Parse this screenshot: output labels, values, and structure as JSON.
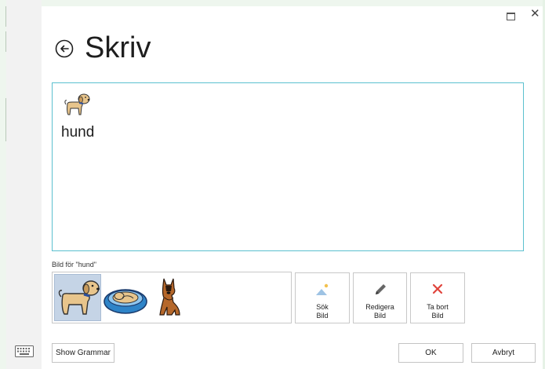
{
  "window": {
    "maximize_glyph": "",
    "close_glyph": "✕"
  },
  "header": {
    "title": "Skriv",
    "back_icon": "back-arrow-circle-icon"
  },
  "editor": {
    "symbol_icon": "dog-symbol-icon",
    "word": "hund"
  },
  "pictures": {
    "label": "Bild för \"hund\"",
    "items": [
      {
        "icon": "dog-icon",
        "selected": true
      },
      {
        "icon": "dog-bed-icon",
        "selected": false
      },
      {
        "icon": "german-shepherd-icon",
        "selected": false
      }
    ]
  },
  "actions": {
    "search": {
      "line1": "Sök",
      "line2": "Bild",
      "icon": "image-search-icon"
    },
    "edit": {
      "line1": "Redigera",
      "line2": "Bild",
      "icon": "pencil-icon"
    },
    "remove": {
      "line1": "Ta bort",
      "line2": "Bild",
      "icon": "red-x-icon"
    }
  },
  "footer": {
    "show_grammar": "Show Grammar",
    "ok": "OK",
    "cancel": "Avbryt",
    "keyboard_icon": "keyboard-icon"
  },
  "colors": {
    "accent_border": "#5bc0cf",
    "selected_bg": "#c5d4e6",
    "remove_red": "#e0443c",
    "dog_tan": "#e8c58c"
  }
}
